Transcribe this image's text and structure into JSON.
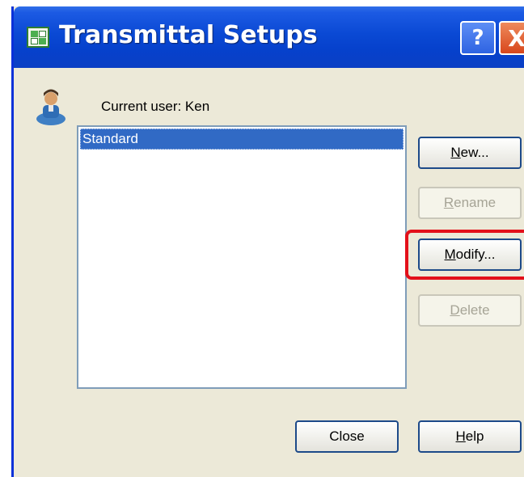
{
  "window": {
    "title": "Transmittal Setups",
    "help_glyph": "?",
    "close_glyph": "X"
  },
  "user": {
    "label": "Current user: Ken",
    "icon": "user-avatar-icon"
  },
  "setups": {
    "items": [
      {
        "label": "Standard",
        "selected": true
      }
    ]
  },
  "buttons": {
    "new": {
      "prefix": "",
      "accel": "N",
      "suffix": "ew...",
      "enabled": true
    },
    "rename": {
      "prefix": "",
      "accel": "R",
      "suffix": "ename",
      "enabled": false
    },
    "modify": {
      "prefix": "",
      "accel": "M",
      "suffix": "odify...",
      "enabled": true,
      "highlighted": true
    },
    "delete": {
      "prefix": "",
      "accel": "D",
      "suffix": "elete",
      "enabled": false
    },
    "close": {
      "label": "Close"
    },
    "help": {
      "prefix": "",
      "accel": "H",
      "suffix": "elp"
    }
  },
  "colors": {
    "titlebar": "#0a49d4",
    "selection": "#316ac5",
    "highlight": "#e3101a"
  }
}
